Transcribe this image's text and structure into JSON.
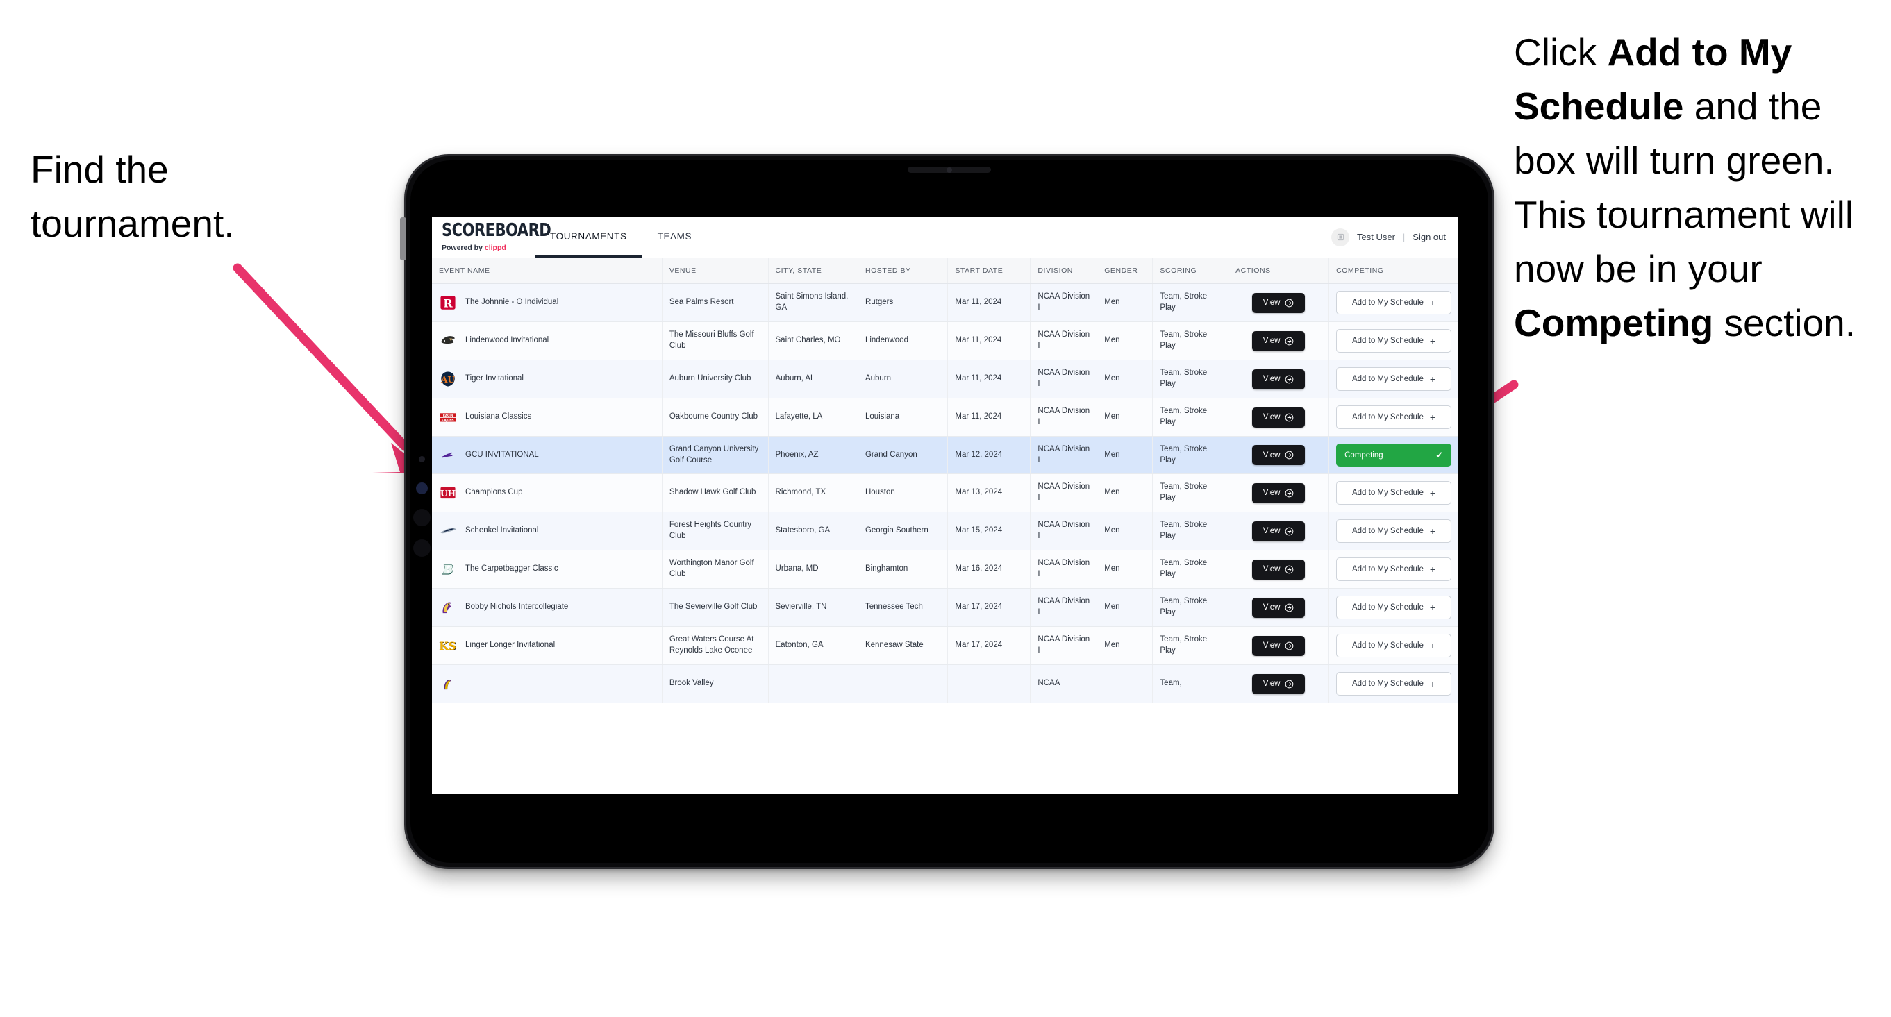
{
  "annotations": {
    "left": "Find the tournament.",
    "right_parts": [
      {
        "t": "Click ",
        "b": false
      },
      {
        "t": "Add to My Schedule",
        "b": true
      },
      {
        "t": " and the box will turn green. This tournament will now be in your ",
        "b": false
      },
      {
        "t": "Competing",
        "b": true
      },
      {
        "t": " section.",
        "b": false
      }
    ],
    "arrow_color": "#E8336B"
  },
  "app": {
    "brand_title": "SCOREBOARD",
    "brand_powered_prefix": "Powered by ",
    "brand_powered_name": "clippd",
    "nav": [
      {
        "label": "TOURNAMENTS",
        "active": true
      },
      {
        "label": "TEAMS",
        "active": false
      }
    ],
    "user": {
      "avatar_icon": "user-badge-icon",
      "name": "Test User",
      "separator": "|",
      "signout": "Sign out"
    }
  },
  "table": {
    "columns": [
      "EVENT NAME",
      "VENUE",
      "CITY, STATE",
      "HOSTED BY",
      "START DATE",
      "DIVISION",
      "GENDER",
      "SCORING",
      "ACTIONS",
      "COMPETING"
    ],
    "view_label": "View",
    "add_label": "Add to My Schedule",
    "competing_label": "Competing",
    "rows": [
      {
        "logo": "rutgers-r-logo",
        "event": "The Johnnie - O Individual",
        "venue": "Sea Palms Resort",
        "city": "Saint Simons Island, GA",
        "host": "Rutgers",
        "date": "Mar 11, 2024",
        "division": "NCAA Division I",
        "gender": "Men",
        "scoring": "Team, Stroke Play",
        "competing": false
      },
      {
        "logo": "lindenwood-lion-logo",
        "event": "Lindenwood Invitational",
        "venue": "The Missouri Bluffs Golf Club",
        "city": "Saint Charles, MO",
        "host": "Lindenwood",
        "date": "Mar 11, 2024",
        "division": "NCAA Division I",
        "gender": "Men",
        "scoring": "Team, Stroke Play",
        "competing": false
      },
      {
        "logo": "auburn-au-logo",
        "event": "Tiger Invitational",
        "venue": "Auburn University Club",
        "city": "Auburn, AL",
        "host": "Auburn",
        "date": "Mar 11, 2024",
        "division": "NCAA Division I",
        "gender": "Men",
        "scoring": "Team, Stroke Play",
        "competing": false
      },
      {
        "logo": "louisiana-ragin-cajuns-logo",
        "event": "Louisiana Classics",
        "venue": "Oakbourne Country Club",
        "city": "Lafayette, LA",
        "host": "Louisiana",
        "date": "Mar 11, 2024",
        "division": "NCAA Division I",
        "gender": "Men",
        "scoring": "Team, Stroke Play",
        "competing": false
      },
      {
        "logo": "grand-canyon-lope-logo",
        "event": "GCU INVITATIONAL",
        "venue": "Grand Canyon University Golf Course",
        "city": "Phoenix, AZ",
        "host": "Grand Canyon",
        "date": "Mar 12, 2024",
        "division": "NCAA Division I",
        "gender": "Men",
        "scoring": "Team, Stroke Play",
        "competing": true
      },
      {
        "logo": "houston-uh-logo",
        "event": "Champions Cup",
        "venue": "Shadow Hawk Golf Club",
        "city": "Richmond, TX",
        "host": "Houston",
        "date": "Mar 13, 2024",
        "division": "NCAA Division I",
        "gender": "Men",
        "scoring": "Team, Stroke Play",
        "competing": false
      },
      {
        "logo": "georgia-southern-eagle-logo",
        "event": "Schenkel Invitational",
        "venue": "Forest Heights Country Club",
        "city": "Statesboro, GA",
        "host": "Georgia Southern",
        "date": "Mar 15, 2024",
        "division": "NCAA Division I",
        "gender": "Men",
        "scoring": "Team, Stroke Play",
        "competing": false
      },
      {
        "logo": "binghamton-b-logo",
        "event": "The Carpetbagger Classic",
        "venue": "Worthington Manor Golf Club",
        "city": "Urbana, MD",
        "host": "Binghamton",
        "date": "Mar 16, 2024",
        "division": "NCAA Division I",
        "gender": "Men",
        "scoring": "Team, Stroke Play",
        "competing": false
      },
      {
        "logo": "tennessee-tech-eagle-logo",
        "event": "Bobby Nichols Intercollegiate",
        "venue": "The Sevierville Golf Club",
        "city": "Sevierville, TN",
        "host": "Tennessee Tech",
        "date": "Mar 17, 2024",
        "division": "NCAA Division I",
        "gender": "Men",
        "scoring": "Team, Stroke Play",
        "competing": false
      },
      {
        "logo": "kennesaw-state-ks-logo",
        "event": "Linger Longer Invitational",
        "venue": "Great Waters Course At Reynolds Lake Oconee",
        "city": "Eatonton, GA",
        "host": "Kennesaw State",
        "date": "Mar 17, 2024",
        "division": "NCAA Division I",
        "gender": "Men",
        "scoring": "Team, Stroke Play",
        "competing": false
      },
      {
        "logo": "east-carolina-pirate-logo",
        "event": "",
        "venue": "Brook Valley",
        "city": "",
        "host": "",
        "date": "",
        "division": "NCAA",
        "gender": "",
        "scoring": "Team,",
        "competing": false
      }
    ]
  }
}
